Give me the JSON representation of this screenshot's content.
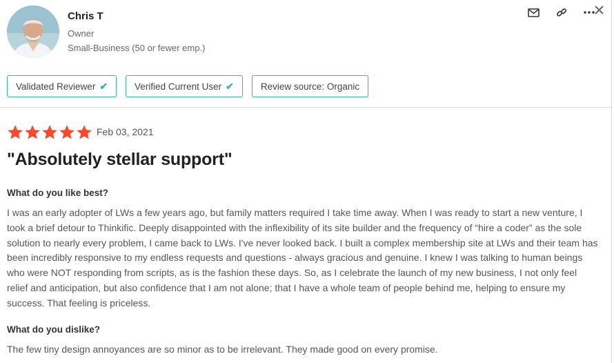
{
  "reviewer": {
    "name": "Chris T",
    "role": "Owner",
    "company_size": "Small-Business (50 or fewer emp.)"
  },
  "actions": {
    "icons": [
      "mail-icon",
      "link-icon",
      "more-icon",
      "close-icon"
    ]
  },
  "badges": [
    {
      "label": "Validated Reviewer",
      "checked": true
    },
    {
      "label": "Verified Current User",
      "checked": true
    },
    {
      "label": "Review source: Organic",
      "checked": false
    }
  ],
  "review": {
    "rating": 5,
    "rating_max": 5,
    "star_color": "#ff492c",
    "date": "Feb 03, 2021",
    "title": "\"Absolutely stellar support\"",
    "questions": [
      {
        "question": "What do you like best?",
        "answer": "I was an early adopter of LWs a few years ago, but family matters required I take time away. When I was ready to start a new venture, I took a brief detour to Thinkific. Deeply disappointed with the inflexibility of its site builder and the frequency of “hire a coder” as the sole solution to nearly every problem, I came back to LWs. I've never looked back. I built a complex membership site at LWs and their team has been incredibly responsive to my endless requests and questions - always gracious and genuine. I knew I was talking to human beings who were NOT responding from scripts, as is the fashion these days. So, as I celebrate the launch of my new business, I not only feel relief and anticipation, but also confidence that I am not alone; that I have a whole team of people behind me, helping to ensure my success. That feeling is priceless."
      },
      {
        "question": "What do you dislike?",
        "answer": "The few tiny design annoyances are so minor as to be irrelevant. They made good on every promise."
      }
    ]
  },
  "colors": {
    "badge_border": "#36b5a2",
    "check": "#36b5a2"
  }
}
